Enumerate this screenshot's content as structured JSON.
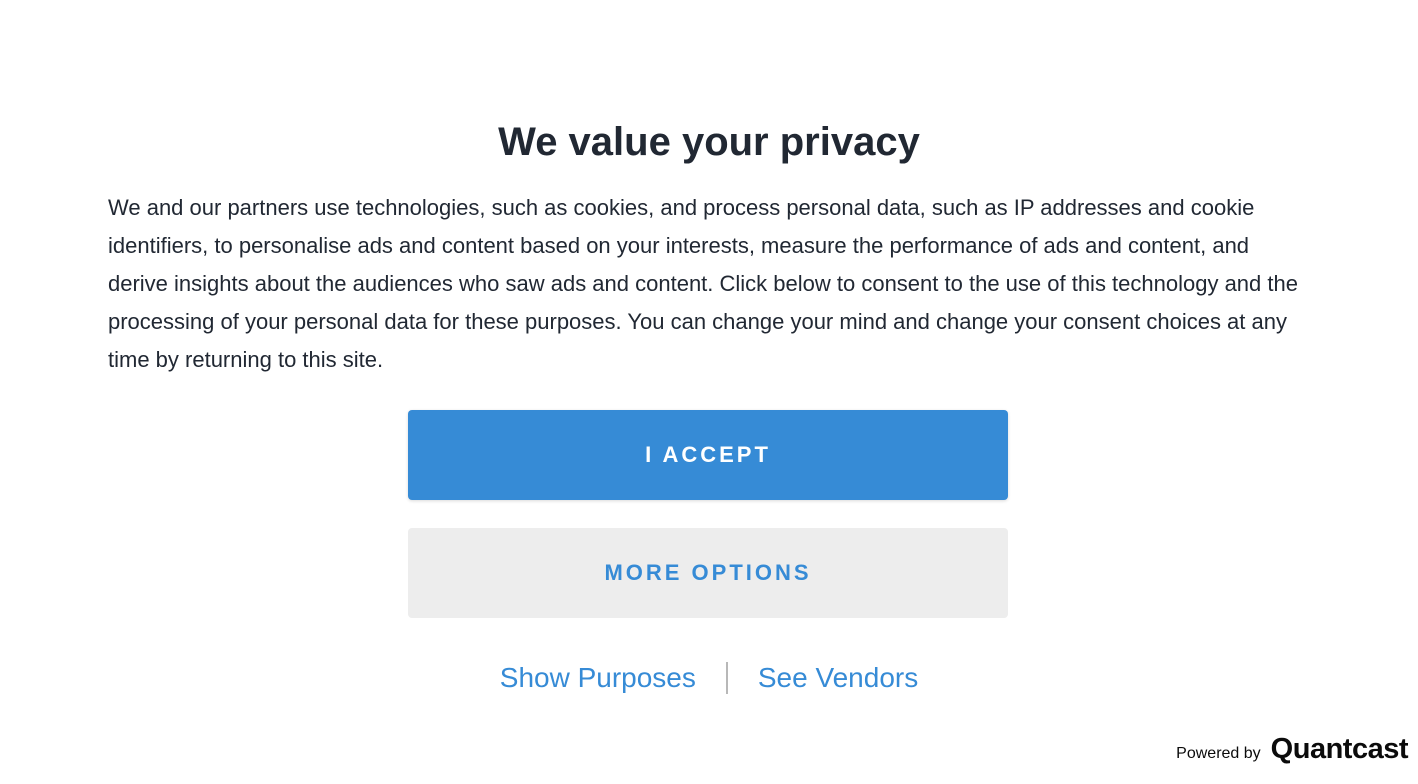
{
  "dialog": {
    "title": "We value your privacy",
    "body": "We and our partners use technologies, such as cookies, and process personal data, such as IP addresses and cookie identifiers, to personalise ads and content based on your interests, measure the performance of ads and content, and derive insights about the audiences who saw ads and content. Click below to consent to the use of this technology and the processing of your personal data for these purposes. You can change your mind and change your consent choices at any time by returning to this site.",
    "accept_label": "I ACCEPT",
    "more_options_label": "MORE OPTIONS",
    "show_purposes_label": "Show Purposes",
    "see_vendors_label": "See Vendors"
  },
  "footer": {
    "powered_by_label": "Powered by",
    "brand": "Quantcast"
  },
  "colors": {
    "accent": "#368bd6",
    "text": "#212833",
    "secondary_button_bg": "#ededed"
  }
}
